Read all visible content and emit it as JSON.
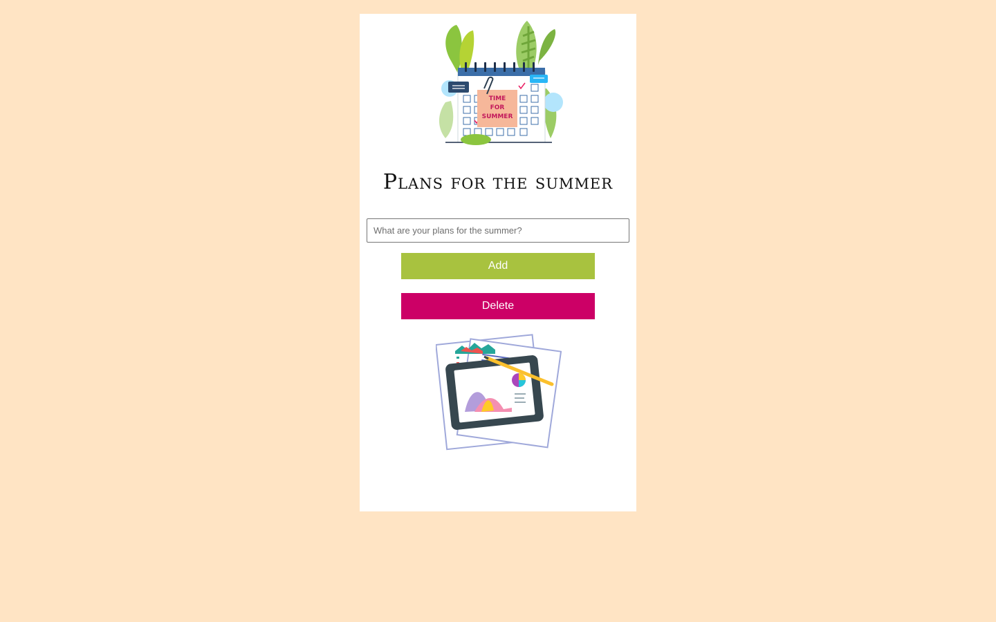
{
  "header": {
    "title": "Plans for the summer",
    "hero_image_icon": "calendar-summer-illustration",
    "hero_sticker_text": [
      "TIME",
      "FOR",
      "SUMMER"
    ]
  },
  "form": {
    "input_placeholder": "What are your plans for the summer?",
    "input_value": "",
    "add_label": "Add",
    "delete_label": "Delete"
  },
  "footer": {
    "image_icon": "tablet-charts-illustration"
  },
  "colors": {
    "background": "#ffe4c4",
    "card": "#ffffff",
    "add_button": "#a8c23f",
    "delete_button": "#cc0066"
  }
}
